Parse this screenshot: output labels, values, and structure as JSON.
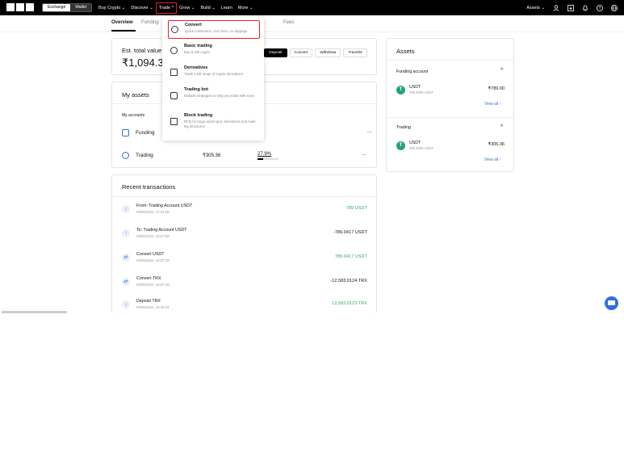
{
  "topbar": {
    "toggle": {
      "exchange": "Exchange",
      "wallet": "Wallet"
    },
    "nav": [
      {
        "label": "Buy Crypto ⌄"
      },
      {
        "label": "Discover ⌄"
      },
      {
        "label": "Trade ^"
      },
      {
        "label": "Grow ⌄"
      },
      {
        "label": "Build ⌄"
      },
      {
        "label": "Learn"
      },
      {
        "label": "More ⌄"
      }
    ],
    "assets_label": "Assets ⌄"
  },
  "subtabs": [
    "Overview",
    "Funding",
    "Fees"
  ],
  "estimate": {
    "label": "Est. total value",
    "value": "₹1,094.3",
    "buttons": [
      "Deposit",
      "Convert",
      "Withdraw",
      "Transfer"
    ]
  },
  "my_assets": {
    "title": "My assets",
    "accounts_label": "My accounts",
    "rows": [
      {
        "name": "Funding",
        "value": "",
        "pct": ""
      },
      {
        "name": "Trading",
        "value": "₹305.36",
        "pct": "27.9%"
      }
    ],
    "more": "..."
  },
  "trade_menu": [
    {
      "title": "Convert",
      "desc": "Quick conversion, zero fees, no slippage"
    },
    {
      "title": "Basic trading",
      "desc": "Buy & sell crypto"
    },
    {
      "title": "Derivatives",
      "desc": "Trade a full range of crypto derivatives"
    },
    {
      "title": "Trading bot",
      "desc": "Multiple strategies to help you trade with ease"
    },
    {
      "title": "Block trading",
      "desc": "RFQ for large-sized spot, derivatives and multi-leg structures"
    }
  ],
  "recent": {
    "title": "Recent transactions",
    "items": [
      {
        "icon": "↓",
        "title": "From: Trading Account USDT",
        "date": "09/05/2022, 17:01:06",
        "amount": "789 USDT",
        "positive": true
      },
      {
        "icon": "↑",
        "title": "To: Trading Account USDT",
        "date": "09/05/2022, 16:57:58",
        "amount": "-789.0417 USDT",
        "positive": false
      },
      {
        "icon": "⇄",
        "title": "Convert USDT",
        "date": "09/05/2022, 16:57:29",
        "amount": "789.0417 USDT",
        "positive": true
      },
      {
        "icon": "⇄",
        "title": "Convert TRX",
        "date": "09/05/2022, 16:57:29",
        "amount": "-12,583.0124 TRX",
        "positive": false
      },
      {
        "icon": "↓",
        "title": "Deposit TRX",
        "date": "09/05/2022, 16:39:42",
        "amount": "12,583.0123 TRX",
        "positive": true
      }
    ]
  },
  "assets_panel": {
    "title": "Assets",
    "sections": [
      {
        "name": "Funding account",
        "token": "USDT",
        "qty": "789.0000 USDT",
        "value": "₹789.00",
        "view_all": "View all ›"
      },
      {
        "name": "Trading",
        "token": "USDT",
        "qty": "305.3659 USDT",
        "value": "₹305.36",
        "view_all": "View all ›"
      }
    ]
  },
  "colors": {
    "accent_blue": "#3a6fd8",
    "green": "#2fae62",
    "tether": "#26a17b",
    "highlight": "#e5202d"
  }
}
